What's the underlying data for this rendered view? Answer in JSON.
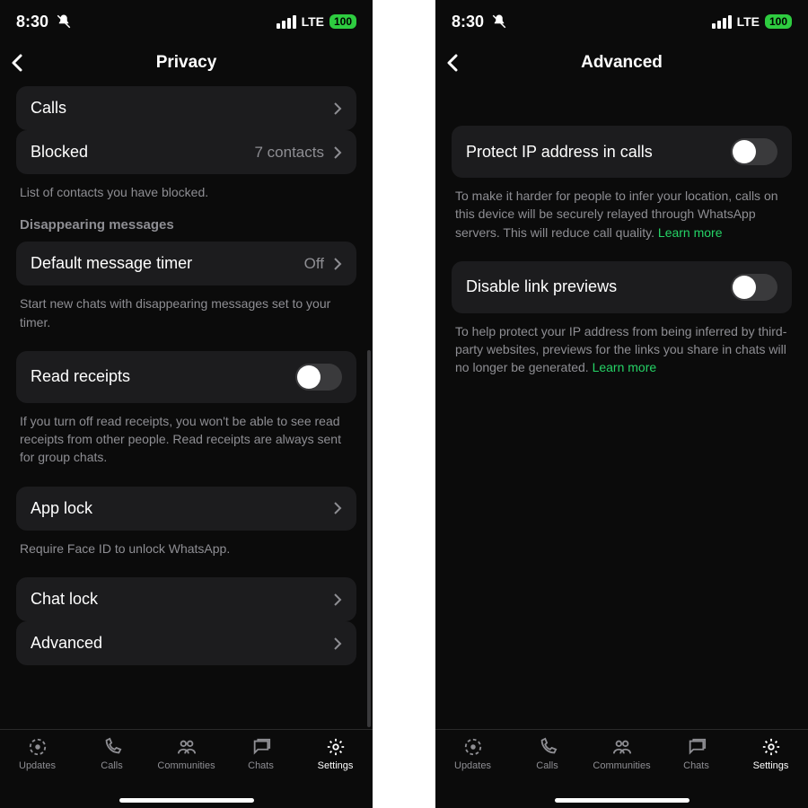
{
  "status": {
    "time": "8:30",
    "net": "LTE",
    "battery": "100"
  },
  "left": {
    "title": "Privacy",
    "rows": {
      "calls": "Calls",
      "blocked_label": "Blocked",
      "blocked_value": "7 contacts",
      "blocked_caption": "List of contacts you have blocked.",
      "disappearing_head": "Disappearing messages",
      "timer_label": "Default message timer",
      "timer_value": "Off",
      "timer_caption": "Start new chats with disappearing messages set to your timer.",
      "readreceipts_label": "Read receipts",
      "readreceipts_caption": "If you turn off read receipts, you won't be able to see read receipts from other people. Read receipts are always sent for group chats.",
      "applock_label": "App lock",
      "applock_caption": "Require Face ID to unlock WhatsApp.",
      "chatlock_label": "Chat lock",
      "advanced_label": "Advanced"
    }
  },
  "right": {
    "title": "Advanced",
    "rows": {
      "protectip_label": "Protect IP address in calls",
      "protectip_caption": "To make it harder for people to infer your location, calls on this device will be securely relayed through WhatsApp servers. This will reduce call quality. ",
      "learn_more": "Learn more",
      "disablelink_label": "Disable link previews",
      "disablelink_caption": "To help protect your IP address from being inferred by third-party websites, previews for the links you share in chats will no longer be generated. "
    }
  },
  "tabs": {
    "updates": "Updates",
    "calls": "Calls",
    "communities": "Communities",
    "chats": "Chats",
    "settings": "Settings"
  }
}
